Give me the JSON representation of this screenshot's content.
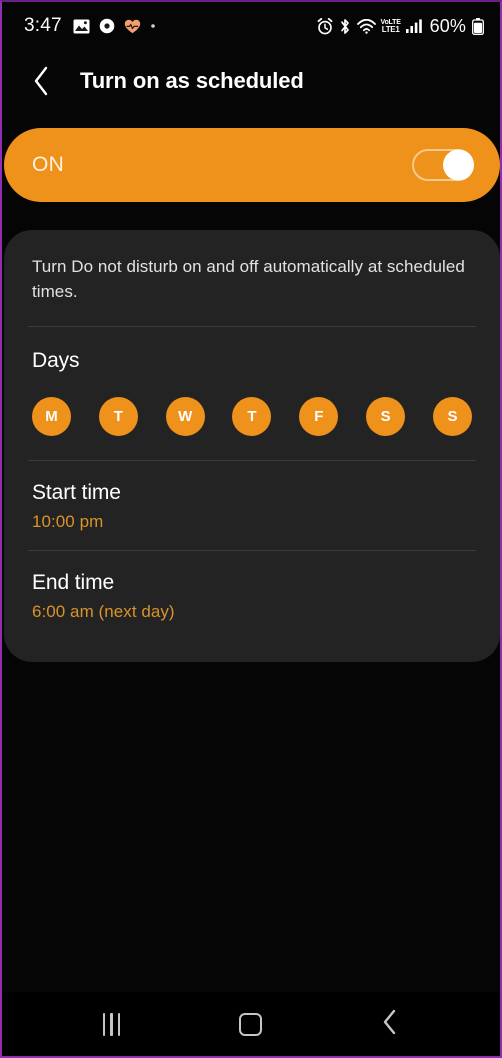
{
  "status_bar": {
    "clock": "3:47",
    "left_icons": [
      {
        "name": "gallery-icon"
      },
      {
        "name": "record-icon"
      },
      {
        "name": "heart-health-icon"
      },
      {
        "name": "dot-indicator-icon"
      }
    ],
    "right_icons": [
      {
        "name": "alarm-icon"
      },
      {
        "name": "bluetooth-icon"
      },
      {
        "name": "wifi-icon"
      },
      {
        "name": "volte-icon"
      },
      {
        "name": "signal-bars-icon"
      }
    ],
    "volte_top_label": "VoLTE",
    "volte_bottom_label": "LTE1",
    "battery_percent": "60%",
    "battery_icon_name": "battery-icon"
  },
  "app_bar": {
    "back_icon_name": "chevron-left-icon",
    "title": "Turn on as scheduled"
  },
  "master_switch": {
    "label": "ON",
    "state": "on",
    "accent_color": "#ef921b",
    "label_color": "#fdf2e3"
  },
  "card": {
    "description": "Turn Do not disturb on and off automatically at scheduled times.",
    "days_label": "Days",
    "days": [
      {
        "label": "M",
        "full": "Monday",
        "selected": true
      },
      {
        "label": "T",
        "full": "Tuesday",
        "selected": true
      },
      {
        "label": "W",
        "full": "Wednesday",
        "selected": true
      },
      {
        "label": "T",
        "full": "Thursday",
        "selected": true
      },
      {
        "label": "F",
        "full": "Friday",
        "selected": true
      },
      {
        "label": "S",
        "full": "Saturday",
        "selected": true
      },
      {
        "label": "S",
        "full": "Sunday",
        "selected": true
      }
    ],
    "start_time": {
      "title": "Start time",
      "value": "10:00 pm"
    },
    "end_time": {
      "title": "End time",
      "value": "6:00 am (next day)"
    }
  },
  "nav_bar": {
    "recents_name": "recents-button",
    "home_name": "home-button",
    "back_name": "back-button"
  },
  "theme": {
    "background": "#050505",
    "card_background": "#232323",
    "accent": "#ef921b",
    "value_text": "#d9932b",
    "divider": "#3b3b3b"
  }
}
